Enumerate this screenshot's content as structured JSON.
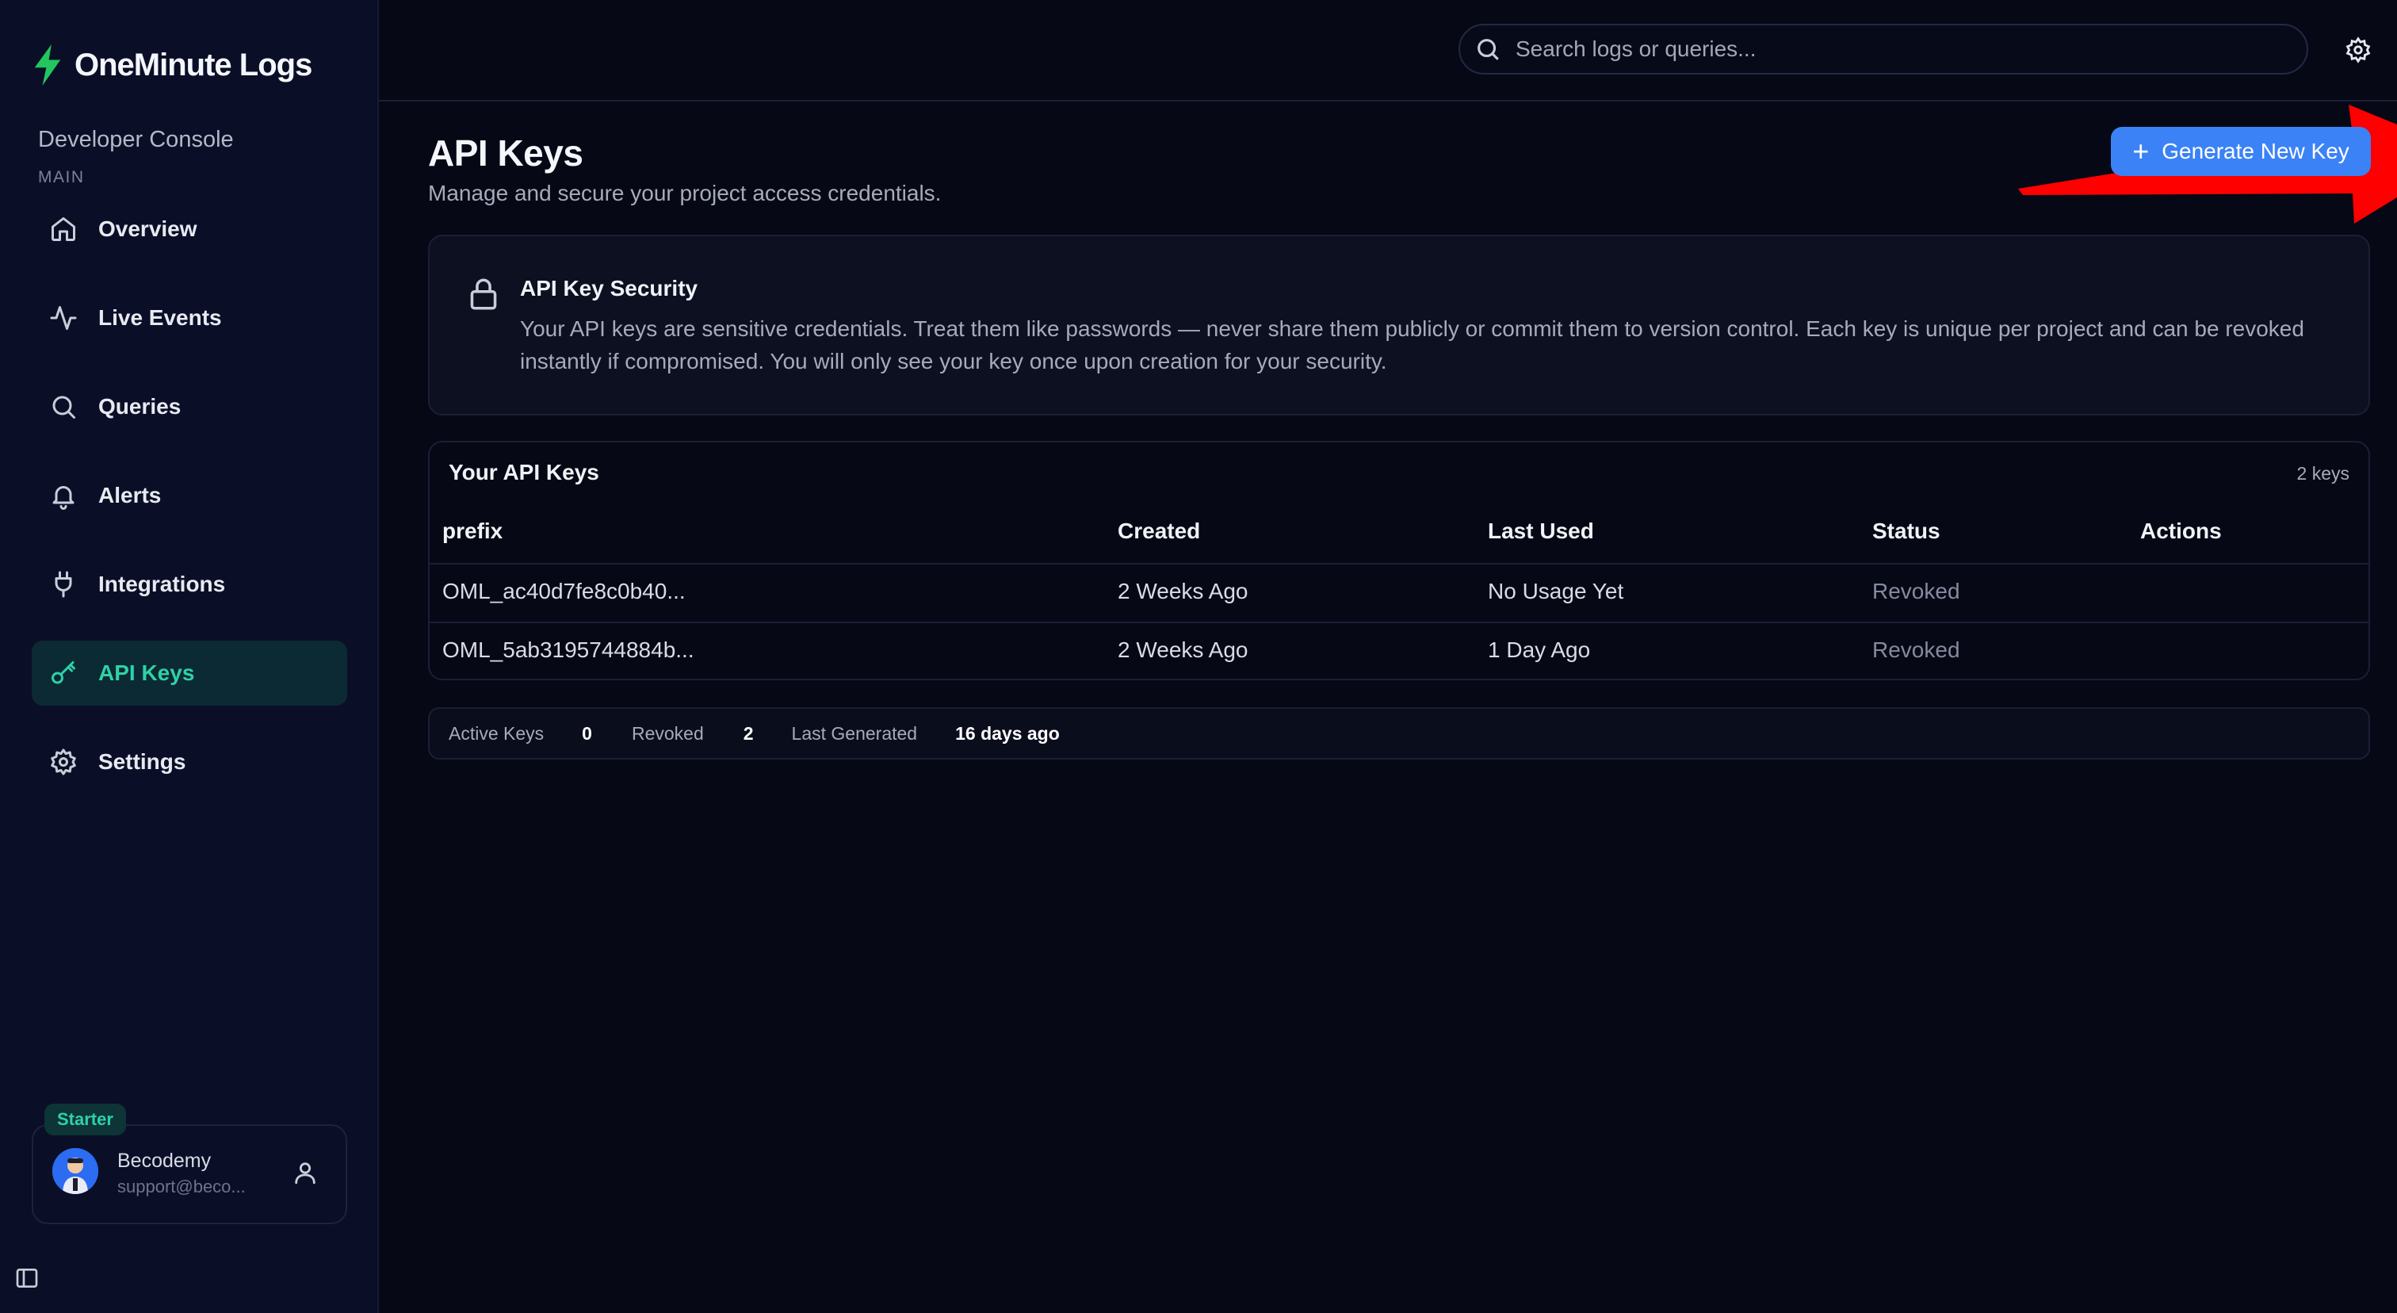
{
  "brand": {
    "name": "OneMinute Logs",
    "accent": "#22c55e"
  },
  "sidebar": {
    "console_label": "Developer Console",
    "section_label": "MAIN",
    "items": [
      {
        "label": "Overview",
        "icon": "home-icon"
      },
      {
        "label": "Live Events",
        "icon": "activity-icon"
      },
      {
        "label": "Queries",
        "icon": "search-icon"
      },
      {
        "label": "Alerts",
        "icon": "bell-icon"
      },
      {
        "label": "Integrations",
        "icon": "plug-icon"
      },
      {
        "label": "API Keys",
        "icon": "key-icon",
        "active": true
      },
      {
        "label": "Settings",
        "icon": "gear-icon"
      }
    ],
    "user": {
      "plan": "Starter",
      "name": "Becodemy",
      "email": "support@beco..."
    }
  },
  "search": {
    "placeholder": "Search logs or queries..."
  },
  "page": {
    "title": "API Keys",
    "subtitle": "Manage and secure your project access credentials.",
    "generate_button": "Generate New Key"
  },
  "security": {
    "title": "API Key Security",
    "text": "Your API keys are sensitive credentials. Treat them like passwords — never share them publicly or commit them to version control. Each key is unique per project and can be revoked instantly if compromised. You will only see your key once upon creation for your security."
  },
  "keys_table": {
    "title": "Your API Keys",
    "count": "2 keys",
    "columns": [
      "prefix",
      "Created",
      "Last Used",
      "Status",
      "Actions"
    ],
    "rows": [
      {
        "prefix": "OML_ac40d7fe8c0b40...",
        "created": "2 Weeks Ago",
        "last_used": "No Usage Yet",
        "status": "Revoked"
      },
      {
        "prefix": "OML_5ab3195744884b...",
        "created": "2 Weeks Ago",
        "last_used": "1 Day Ago",
        "status": "Revoked"
      }
    ]
  },
  "stats": {
    "active_label": "Active Keys",
    "active_value": "0",
    "revoked_label": "Revoked",
    "revoked_value": "2",
    "last_label": "Last Generated",
    "last_value": "16 days ago"
  },
  "colors": {
    "primary": "#3b82f6",
    "active_nav": "#2fd0a8",
    "annotation": "#ff0000"
  }
}
